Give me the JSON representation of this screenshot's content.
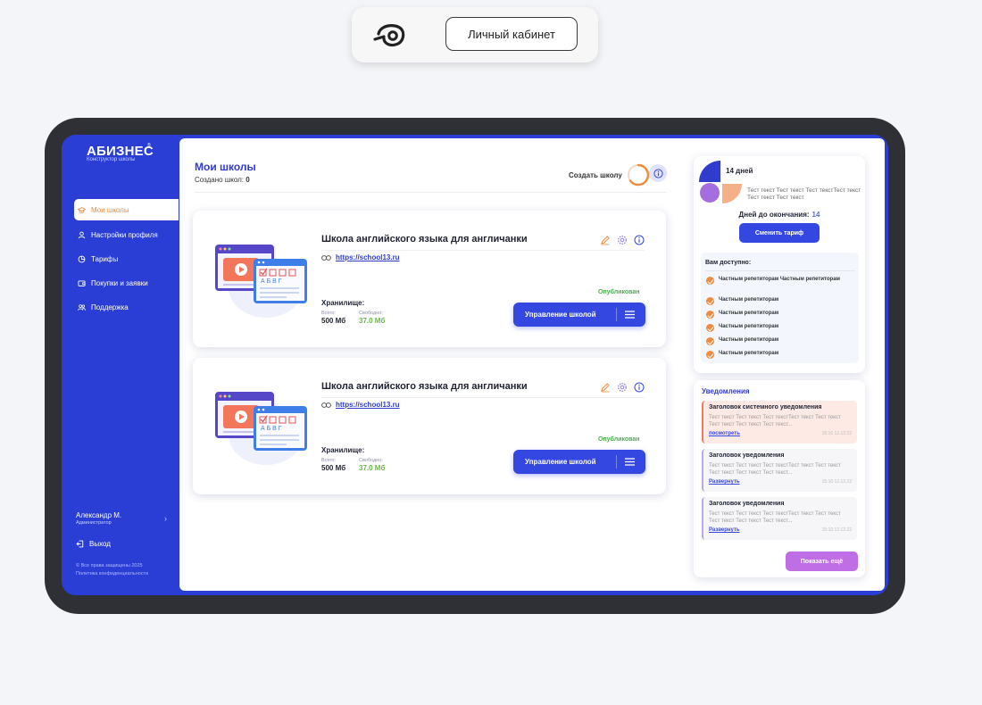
{
  "topbar": {
    "cabinet_label": "Личный кабинет"
  },
  "brand": {
    "name": "АБИЗНЕС",
    "subtitle": "Конструктор школы",
    "reg": "®"
  },
  "sidebar": {
    "items": [
      {
        "label": "Мои школы",
        "icon": "graduation-cap-icon",
        "active": true
      },
      {
        "label": "Настройки профиля",
        "icon": "user-icon"
      },
      {
        "label": "Тарифы",
        "icon": "pie-chart-icon"
      },
      {
        "label": "Покупки и заявки",
        "icon": "wallet-icon"
      },
      {
        "label": "Поддержка",
        "icon": "users-icon"
      }
    ],
    "user_name": "Александр М.",
    "user_role": "Администратор",
    "logout_label": "Выход",
    "copyright": "© Все права защищены 2025",
    "privacy": "Политика конфиденциальности"
  },
  "main": {
    "title": "Мои школы",
    "created_label": "Создано школ:",
    "created_count": "0",
    "create_label": "Создать школу"
  },
  "schools": [
    {
      "title": "Школа английского языка для англичанки",
      "url": "https://school13.ru",
      "status": "Опубликован",
      "storage_label": "Хранилище:",
      "total_caption": "Всего:",
      "total_value": "500 Мб",
      "free_caption": "Свободно:",
      "free_value": "37.0 Мб",
      "manage_label": "Управление школой"
    },
    {
      "title": "Школа английского языка для англичанки",
      "url": "https://school13.ru",
      "status": "Опубликован",
      "storage_label": "Хранилище:",
      "total_caption": "Всего:",
      "total_value": "500 Мб",
      "free_caption": "Свободно:",
      "free_value": "37.0 Мб",
      "manage_label": "Управление школой"
    }
  ],
  "tariff": {
    "days_heading": "14 дней",
    "text": "Тест текст Тест текст Тест текстТест текст Тест текст Тест текст",
    "days_left_label": "Дней до окончания:",
    "days_left_value": "14",
    "change_label": "Сменить тариф",
    "available_title": "Вам доступно:",
    "features": [
      "Частным репетиторам Частным репетиторам",
      "Частным репетиторам",
      "Частным репетиторам",
      "Частным репетиторам",
      "Частным репетиторам",
      "Частным репетиторам"
    ]
  },
  "notifications": {
    "title": "Уведомления",
    "items": [
      {
        "heading": "Заголовок системного уведомления",
        "body": "Тест текст Тест текст Тест текстТест текст Тест текст Тест текст Тест текст Тест текст...",
        "link": "посмотреть",
        "time": "15:10   12.12.22"
      },
      {
        "heading": "Заголовок уведомления",
        "body": "Тест текст Тест текст Тест текстТест текст Тест текст Тест текст Тест текст Тест текст...",
        "link": "Развернуть",
        "time": "15:10   12.12.22"
      },
      {
        "heading": "Заголовок уведомления",
        "body": "Тест текст Тест текст Тест текстТест текст Тест текст Тест текст Тест текст Тест текст...",
        "link": "Развернуть",
        "time": "15:10   12.12.22"
      }
    ],
    "more_label": "Показать ещё"
  },
  "colors": {
    "primary": "#3447e0",
    "sidebar": "#2a3ed6",
    "accent_orange": "#f08a3c",
    "published_green": "#4caf50",
    "more_button": "#c06ee6"
  }
}
